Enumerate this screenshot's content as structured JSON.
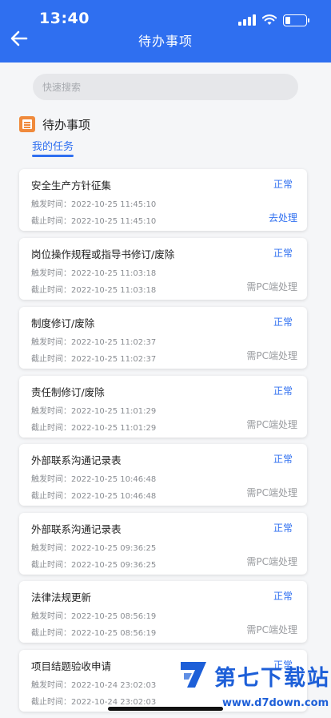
{
  "status_bar": {
    "time": "13:40"
  },
  "header": {
    "title": "待办事项"
  },
  "search": {
    "placeholder": "快速搜索"
  },
  "section": {
    "title": "待办事项",
    "tab": "我的任务"
  },
  "tasks": [
    {
      "title": "安全生产方针征集",
      "status": "正常",
      "trigger": "触发时间：2022-10-25 11:45:10",
      "deadline": "截止时间：2022-10-25 11:45:10",
      "action": "去处理"
    },
    {
      "title": "岗位操作规程或指导书修订/废除",
      "status": "正常",
      "trigger": "触发时间：2022-10-25 11:03:18",
      "deadline": "截止时间：2022-10-25 11:03:18",
      "action": "需PC端处理"
    },
    {
      "title": "制度修订/废除",
      "status": "正常",
      "trigger": "触发时间：2022-10-25 11:02:37",
      "deadline": "截止时间：2022-10-25 11:02:37",
      "action": "需PC端处理"
    },
    {
      "title": "责任制修订/废除",
      "status": "正常",
      "trigger": "触发时间：2022-10-25 11:01:29",
      "deadline": "截止时间：2022-10-25 11:01:29",
      "action": "需PC端处理"
    },
    {
      "title": "外部联系沟通记录表",
      "status": "正常",
      "trigger": "触发时间：2022-10-25 10:46:48",
      "deadline": "截止时间：2022-10-25 10:46:48",
      "action": "需PC端处理"
    },
    {
      "title": "外部联系沟通记录表",
      "status": "正常",
      "trigger": "触发时间：2022-10-25 09:36:25",
      "deadline": "截止时间：2022-10-25 09:36:25",
      "action": "需PC端处理"
    },
    {
      "title": "法律法规更新",
      "status": "正常",
      "trigger": "触发时间：2022-10-25 08:56:19",
      "deadline": "截止时间：2022-10-25 08:56:19",
      "action": "需PC端处理"
    },
    {
      "title": "项目结题验收申请",
      "status": "正常",
      "trigger": "触发时间：2022-10-24 23:02:03",
      "deadline": "截止时间：2022-10-24 23:02:03",
      "action": ""
    }
  ],
  "watermark": {
    "text": "第七下载站",
    "url": "www.d7down.com"
  },
  "colors": {
    "primary": "#2f6ff0",
    "accent": "#f08a3c",
    "muted": "#9a9ca0"
  }
}
